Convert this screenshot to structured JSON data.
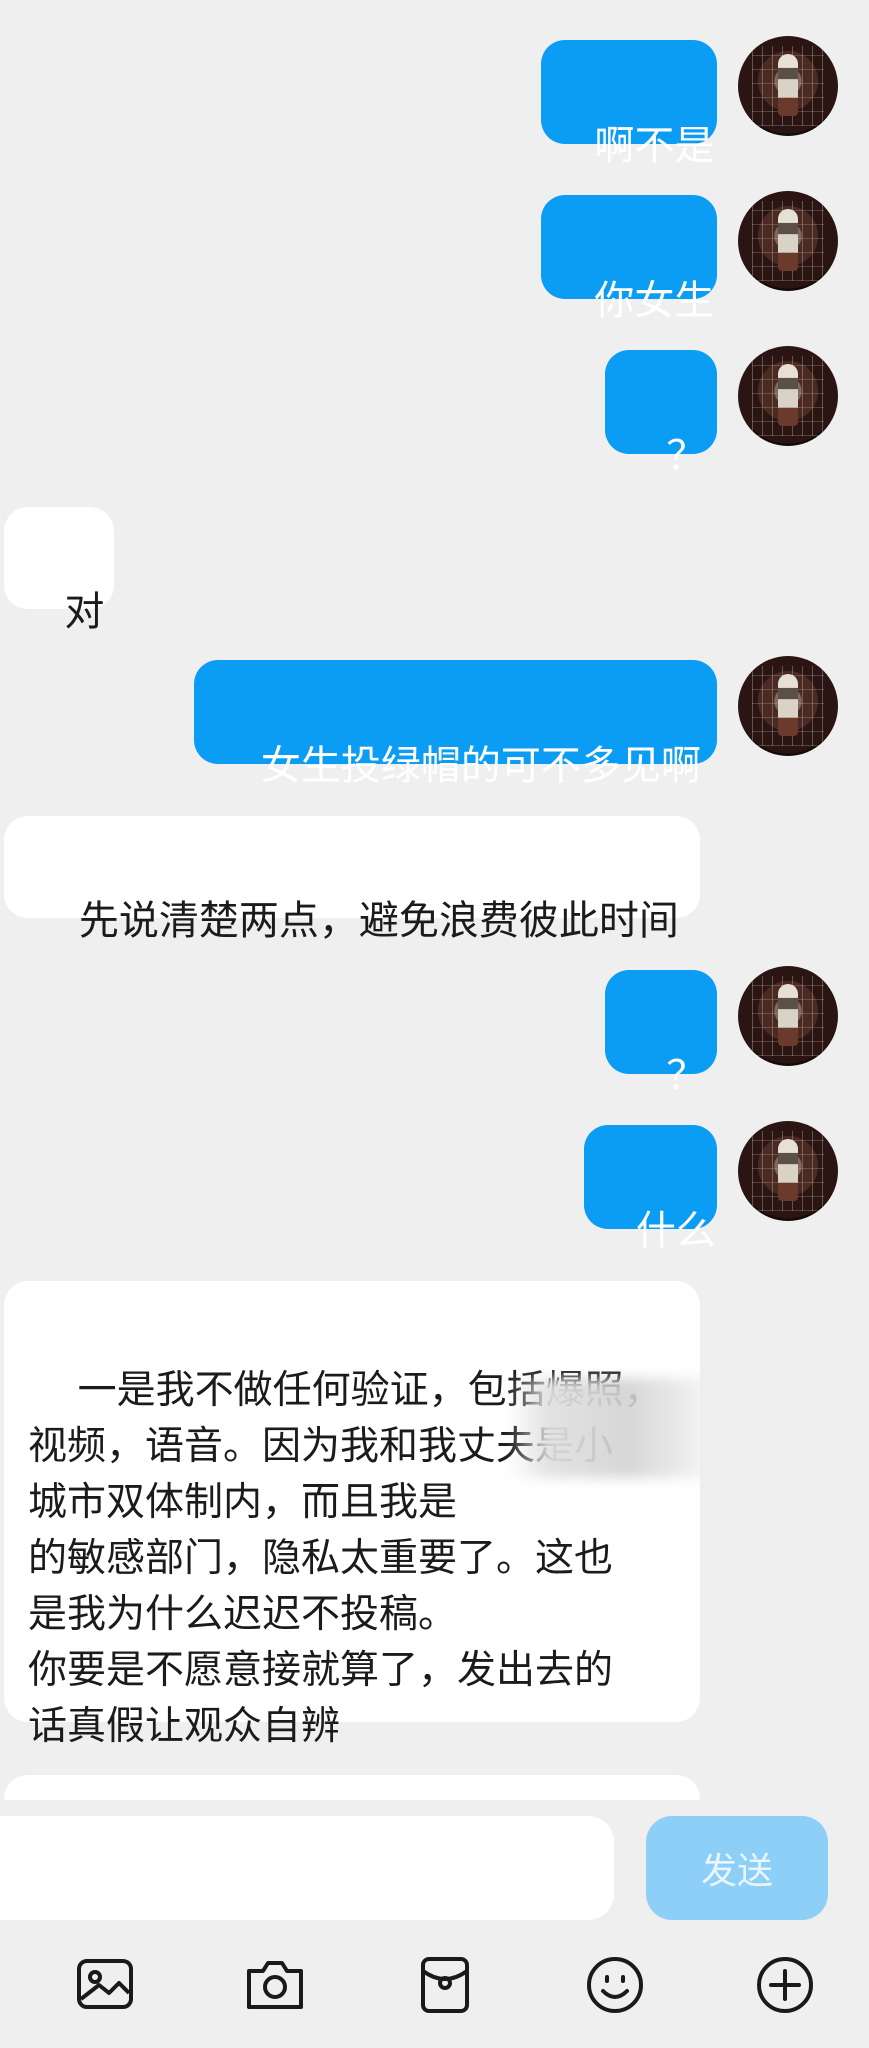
{
  "messages": [
    {
      "side": "out",
      "text": "啊不是"
    },
    {
      "side": "out",
      "text": "你女生"
    },
    {
      "side": "out",
      "text": "？"
    },
    {
      "side": "in",
      "text": "对"
    },
    {
      "side": "out",
      "text": "女生投绿帽的可不多见啊"
    },
    {
      "side": "in",
      "text": "先说清楚两点，避免浪费彼此时间"
    },
    {
      "side": "out",
      "text": "？"
    },
    {
      "side": "out",
      "text": "什么"
    },
    {
      "side": "in",
      "text": "一是我不做任何验证，包括爆照，\n视频，语音。因为我和我丈夫是小\n城市双体制内，而且我是\n的敏感部门，隐私太重要了。这也\n是我为什么迟迟不投稿。\n你要是不愿意接就算了，发出去的\n话真假让观众自辨"
    },
    {
      "side": "in",
      "text": ""
    }
  ],
  "composer": {
    "placeholder": "",
    "send_label": "发送"
  },
  "toolbar": {
    "icons": [
      "image-icon",
      "camera-icon",
      "red-envelope-icon",
      "emoji-icon",
      "plus-icon"
    ]
  },
  "colors": {
    "outgoing_bubble": "#0b9cf4",
    "incoming_bubble": "#ffffff",
    "send_button_disabled": "#8ecff7",
    "background": "#efefef"
  }
}
